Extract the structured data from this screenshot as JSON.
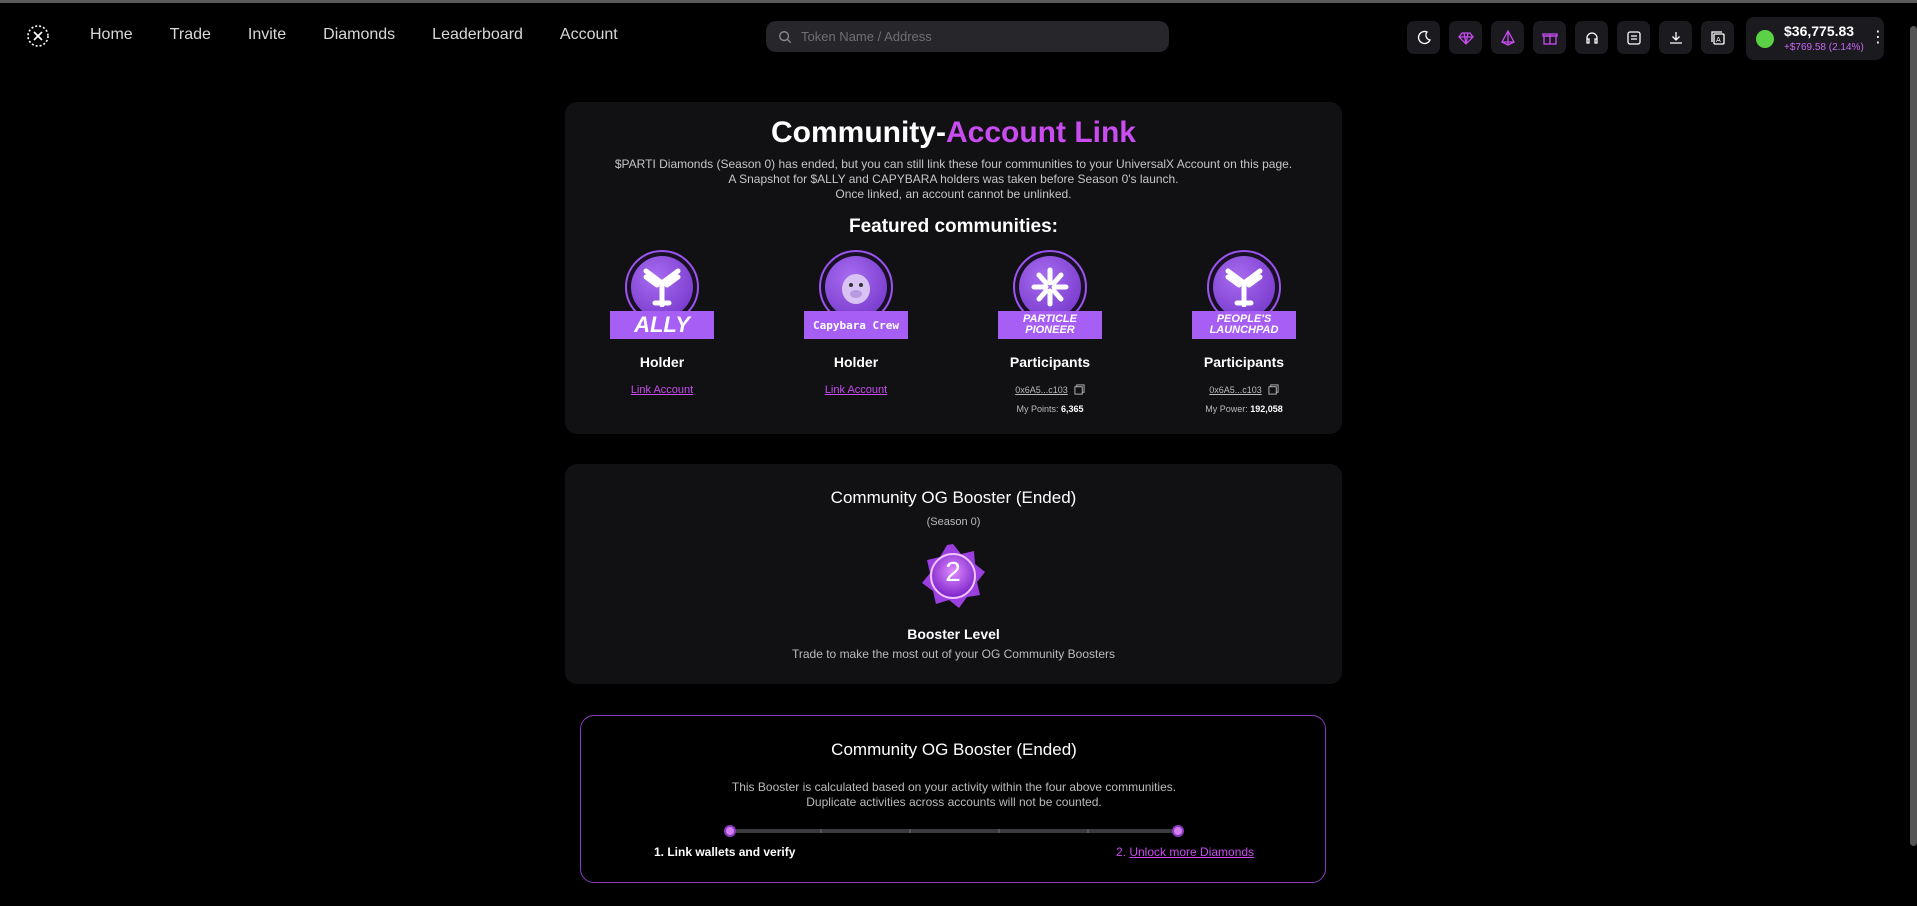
{
  "header": {
    "nav": [
      "Home",
      "Trade",
      "Invite",
      "Diamonds",
      "Leaderboard",
      "Account"
    ],
    "search_placeholder": "Token Name / Address",
    "icons": [
      "moon-icon",
      "diamond-icon",
      "prism-icon",
      "gift-icon",
      "headset-icon",
      "news-icon",
      "download-icon",
      "translate-icon"
    ],
    "wallet": {
      "balance": "$36,775.83",
      "change": "+$769.58 (2.14%)",
      "more": "⋮"
    }
  },
  "link_card": {
    "title_white": "Community-",
    "title_purple": "Account Link",
    "desc_lines": [
      "$PARTI Diamonds (Season 0) has ended, but you can still link these four communities to your UniversalX Account on this page.",
      "A Snapshot for $ALLY and CAPYBARA holders was taken before Season 0's launch.",
      "Once linked, an account cannot be unlinked."
    ],
    "featured_title": "Featured communities:",
    "communities": [
      {
        "banner": "ALLY",
        "role": "Holder",
        "link": "Link Account"
      },
      {
        "banner": "Capybara Crew",
        "role": "Holder",
        "link": "Link Account"
      },
      {
        "banner": "PARTICLE PIONEER",
        "role": "Participants",
        "address": "0x6A5...c103",
        "points_label": "My Points:",
        "points": "6,365"
      },
      {
        "banner": "PEOPLE'S LAUNCHPAD",
        "role": "Participants",
        "address": "0x6A5...c103",
        "points_label": "My Power:",
        "points": "192,058"
      }
    ]
  },
  "booster_card": {
    "title": "Community OG Booster (Ended)",
    "subtitle": "(Season 0)",
    "level": "2",
    "level_label": "Booster Level",
    "desc": "Trade to make the most out of your OG Community Boosters"
  },
  "booster_info": {
    "title": "Community OG Booster (Ended)",
    "desc_lines": [
      "This Booster is calculated based on your activity within the four above communities.",
      "Duplicate activities across accounts will not be counted."
    ],
    "step1": "1. Link wallets and verify",
    "step2_prefix": "2. ",
    "step2_link": "Unlock more Diamonds"
  },
  "colors": {
    "accent": "#c84cf0",
    "badge": "#a65ef5",
    "online": "#5bd245"
  }
}
